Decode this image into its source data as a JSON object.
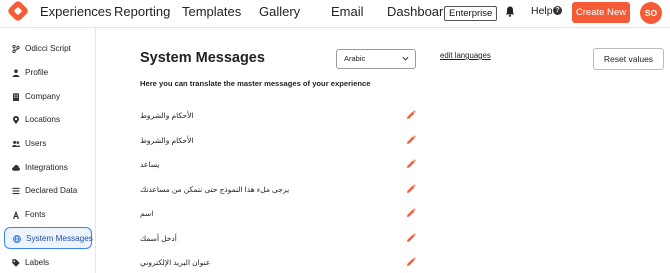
{
  "topbar": {
    "nav": [
      "Experiences",
      "Reporting",
      "Templates",
      "Gallery",
      "Email",
      "Dashboard"
    ],
    "plan_badge": "Enterprise",
    "help_label": "Help",
    "help_icon_glyph": "?",
    "create_label": "Create New",
    "avatar_initials": "SO",
    "accent_color": "#f45b36"
  },
  "sidebar": {
    "items": [
      {
        "label": "Odicci Script",
        "icon": "branch-icon"
      },
      {
        "label": "Profile",
        "icon": "user-icon"
      },
      {
        "label": "Company",
        "icon": "building-icon"
      },
      {
        "label": "Locations",
        "icon": "pin-icon"
      },
      {
        "label": "Users",
        "icon": "users-icon"
      },
      {
        "label": "Integrations",
        "icon": "cloud-icon"
      },
      {
        "label": "Declared Data",
        "icon": "list-icon"
      },
      {
        "label": "Fonts",
        "icon": "font-icon"
      },
      {
        "label": "System Messages",
        "icon": "globe-icon",
        "active": true
      },
      {
        "label": "Labels",
        "icon": "tag-icon"
      }
    ]
  },
  "main": {
    "title": "System Messages",
    "language_select": "Arabic",
    "edit_languages": "edit languages",
    "reset_label": "Reset values",
    "subtitle": "Here you can translate the master messages of your experience",
    "messages": [
      "الأحكام والشروط",
      "الأحكام والشروط",
      "يساعد",
      "يرجى ملء هذا النموذج حتى نتمكن من مساعدتك",
      "اسم",
      "أدخل أسمك",
      "عنوان البريد الإلكتروني"
    ]
  }
}
